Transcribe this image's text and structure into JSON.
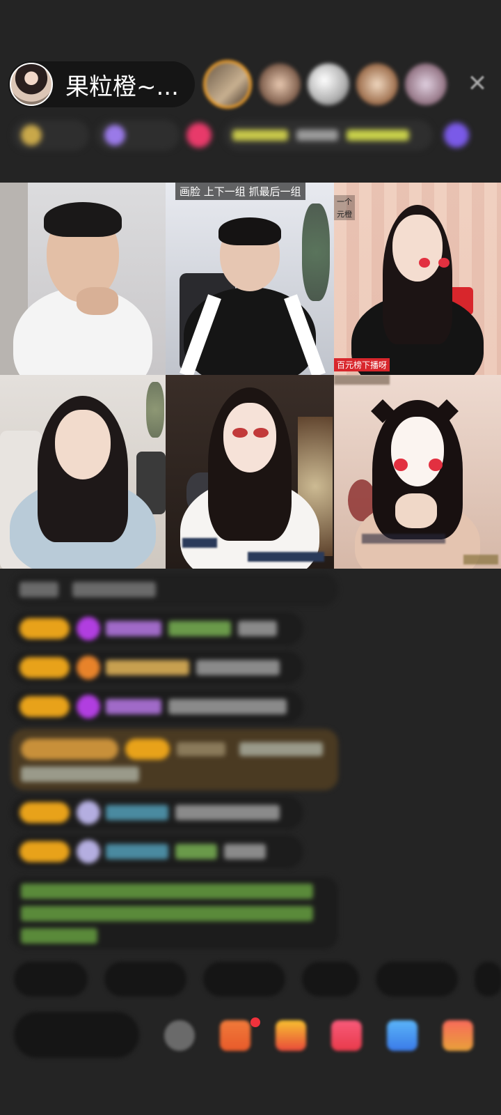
{
  "host": {
    "name": "果粒橙~..."
  },
  "top_bar": {
    "close_icon": "close-icon"
  },
  "colors": {
    "background": "#242424",
    "pill": "#151515",
    "level_badge": "#e8a21a",
    "accent_red": "#d8262c"
  },
  "video_grid": {
    "tiles": [
      {
        "overlay": ""
      },
      {
        "overlay": "画脸 上下一组 抓最后一组"
      },
      {
        "overlay": "一个",
        "overlay2": "元橙",
        "tag": "百元榜下播呀"
      },
      {
        "overlay": ""
      },
      {
        "overlay": ""
      },
      {
        "overlay": ""
      }
    ]
  }
}
